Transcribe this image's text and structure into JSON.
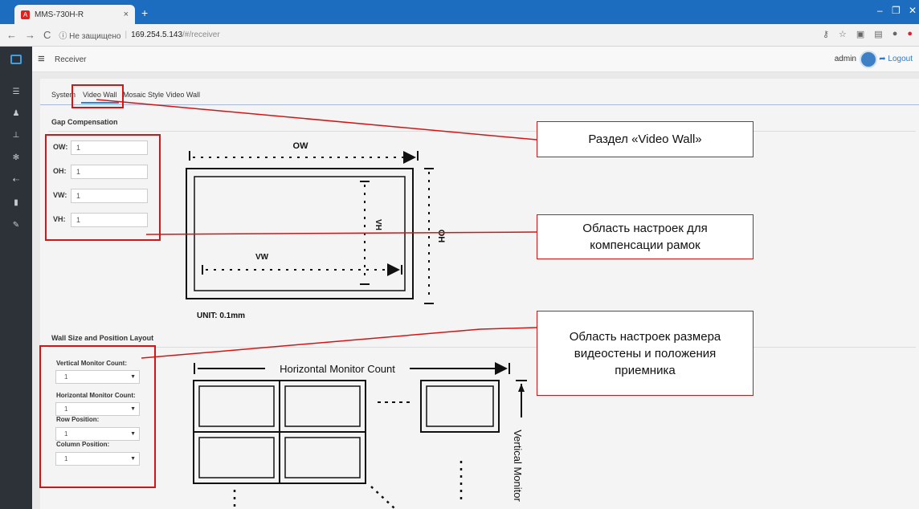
{
  "browser": {
    "tab_title": "MMS-730H-R",
    "tab_close": "×",
    "new_tab": "+",
    "address": {
      "security": "ⓘ Не защищено",
      "host": "169.254.5.143",
      "path": "/#/receiver"
    }
  },
  "app": {
    "title": "Receiver",
    "user": "admin",
    "logout": "Logout"
  },
  "tabs": [
    "System",
    "Video Wall",
    "Mosaic Style Video Wall"
  ],
  "gap": {
    "title": "Gap Compensation",
    "fields": [
      {
        "label": "OW:",
        "value": "1"
      },
      {
        "label": "OH:",
        "value": "1"
      },
      {
        "label": "VW:",
        "value": "1"
      },
      {
        "label": "VH:",
        "value": "1"
      }
    ],
    "diagram": {
      "ow": "OW",
      "oh": "OH",
      "vw": "VW",
      "vh": "VH",
      "unit": "UNIT: 0.1mm"
    }
  },
  "wall": {
    "title": "Wall Size and Position Layout",
    "fields": [
      {
        "label": "Vertical Monitor Count:",
        "value": "1"
      },
      {
        "label": "Horizontal Monitor Count:",
        "value": "1"
      },
      {
        "label": "Row Position:",
        "value": "1"
      },
      {
        "label": "Column Position:",
        "value": "1"
      }
    ],
    "diagram": {
      "hcount": "Horizontal Monitor Count",
      "vcount": "Vertical Monitor"
    }
  },
  "callouts": {
    "c1": "Раздел «Video Wall»",
    "c2": "Область настроек для компенсации рамок",
    "c3": "Область настроек размера видеостены и положения приемника"
  },
  "colors": {
    "accent": "#1e88e5",
    "highlight": "#d41515",
    "sidebar": "#2d3238"
  }
}
